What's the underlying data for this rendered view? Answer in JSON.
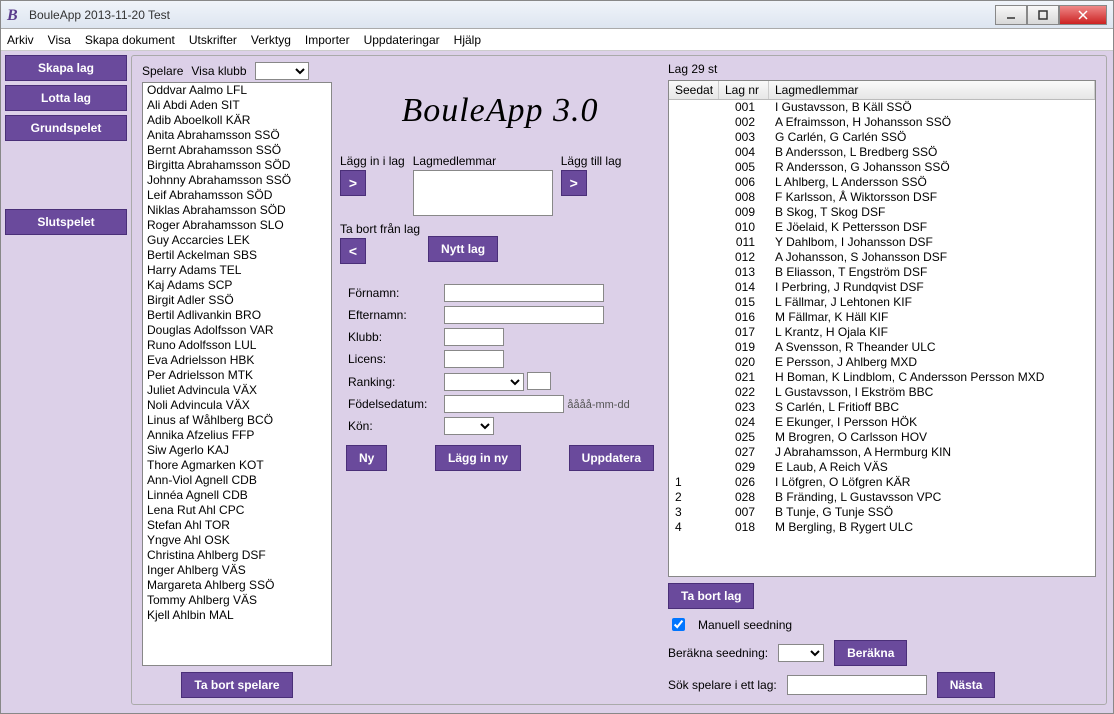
{
  "window": {
    "title": "BouleApp 2013-11-20 Test"
  },
  "menu": {
    "items": [
      "Arkiv",
      "Visa",
      "Skapa dokument",
      "Utskrifter",
      "Verktyg",
      "Importer",
      "Uppdateringar",
      "Hjälp"
    ]
  },
  "sidebar": {
    "skapa_lag": "Skapa lag",
    "lotta_lag": "Lotta lag",
    "grundspelet": "Grundspelet",
    "slutspelet": "Slutspelet"
  },
  "players": {
    "label_spelare": "Spelare",
    "label_visa_klubb": "Visa klubb",
    "list": [
      "Oddvar Aalmo LFL",
      "Ali Abdi Aden SIT",
      "Adib Aboelkoll KÄR",
      "Anita Abrahamsson SSÖ",
      "Bernt Abrahamsson SSÖ",
      "Birgitta Abrahamsson SÖD",
      "Johnny Abrahamsson SSÖ",
      "Leif Abrahamsson SÖD",
      "Niklas Abrahamsson SÖD",
      "Roger Abrahamsson SLO",
      "Guy Accarcies LEK",
      "Bertil Ackelman SBS",
      "Harry Adams TEL",
      "Kaj Adams SCP",
      "Birgit Adler SSÖ",
      "Bertil Adlivankin BRO",
      "Douglas Adolfsson VAR",
      "Runo Adolfsson LUL",
      "Eva Adrielsson HBK",
      "Per Adrielsson MTK",
      "Juliet Advincula VÄX",
      "Noli Advincula VÄX",
      "Linus af Wåhlberg BCÖ",
      "Annika Afzelius FFP",
      "Siw Agerlo KAJ",
      "Thore Agmarken KOT",
      "Ann-Viol Agnell CDB",
      "Linnéa Agnell CDB",
      "Lena Rut Ahl CPC",
      "Stefan Ahl TOR",
      "Yngve Ahl OSK",
      "Christina Ahlberg DSF",
      "Inger Ahlberg VÄS",
      "Margareta Ahlberg SSÖ",
      "Tommy Ahlberg VÄS",
      "Kjell Ahlbin MAL"
    ],
    "ta_bort_spelare": "Ta bort spelare"
  },
  "middle": {
    "logo": "BouleApp 3.0",
    "lagg_in_i_lag": "Lägg in i lag",
    "lagmedlemmar": "Lagmedlemmar",
    "lagg_till_lag": "Lägg till lag",
    "ta_bort_fran_lag": "Ta bort från lag",
    "nytt_lag": "Nytt lag",
    "arrow_r": ">",
    "arrow_l": "<",
    "form": {
      "fornamn": "Förnamn:",
      "efternamn": "Efternamn:",
      "klubb": "Klubb:",
      "licens": "Licens:",
      "ranking": "Ranking:",
      "fodelsedatum": "Födelsedatum:",
      "date_hint": "åååå-mm-dd",
      "kon": "Kön:"
    },
    "ny": "Ny",
    "lagg_in_ny": "Lägg in ny",
    "uppdatera": "Uppdatera"
  },
  "teams": {
    "count_label": "Lag 29 st",
    "col_seedat": "Seedat",
    "col_lagnr": "Lag nr",
    "col_lagmedlemmar": "Lagmedlemmar",
    "rows": [
      {
        "s": "",
        "n": "001",
        "m": "I Gustavsson, B Käll SSÖ"
      },
      {
        "s": "",
        "n": "002",
        "m": "A Efraimsson, H Johansson SSÖ"
      },
      {
        "s": "",
        "n": "003",
        "m": "G Carlén, G Carlén SSÖ"
      },
      {
        "s": "",
        "n": "004",
        "m": "B Andersson, L Bredberg SSÖ"
      },
      {
        "s": "",
        "n": "005",
        "m": "R Andersson, G Johansson SSÖ"
      },
      {
        "s": "",
        "n": "006",
        "m": "L Ahlberg, L Andersson SSÖ"
      },
      {
        "s": "",
        "n": "008",
        "m": "F Karlsson, Å Wiktorsson DSF"
      },
      {
        "s": "",
        "n": "009",
        "m": "B Skog, T Skog DSF"
      },
      {
        "s": "",
        "n": "010",
        "m": "E Jöelaid, K Pettersson DSF"
      },
      {
        "s": "",
        "n": "011",
        "m": "Y Dahlbom, I Johansson DSF"
      },
      {
        "s": "",
        "n": "012",
        "m": "A Johansson, S Johansson DSF"
      },
      {
        "s": "",
        "n": "013",
        "m": "B Eliasson, T Engström DSF"
      },
      {
        "s": "",
        "n": "014",
        "m": "I Perbring, J Rundqvist DSF"
      },
      {
        "s": "",
        "n": "015",
        "m": "L Fällmar, J Lehtonen KIF"
      },
      {
        "s": "",
        "n": "016",
        "m": "M Fällmar, K Häll KIF"
      },
      {
        "s": "",
        "n": "017",
        "m": "L Krantz, H Ojala KIF"
      },
      {
        "s": "",
        "n": "019",
        "m": "A Svensson, R Theander ULC"
      },
      {
        "s": "",
        "n": "020",
        "m": "E Persson, J Ahlberg MXD"
      },
      {
        "s": "",
        "n": "021",
        "m": "H Boman, K Lindblom, C Andersson Persson MXD"
      },
      {
        "s": "",
        "n": "022",
        "m": "L Gustavsson, I Ekström BBC"
      },
      {
        "s": "",
        "n": "023",
        "m": "S Carlén, L Fritioff BBC"
      },
      {
        "s": "",
        "n": "024",
        "m": "E Ekunger, I Persson HÖK"
      },
      {
        "s": "",
        "n": "025",
        "m": "M Brogren, O Carlsson HOV"
      },
      {
        "s": "",
        "n": "027",
        "m": "J Abrahamsson, A Hermburg KIN"
      },
      {
        "s": "",
        "n": "029",
        "m": "E Laub, A Reich VÄS"
      },
      {
        "s": "1",
        "n": "026",
        "m": "I Löfgren, O Löfgren KÄR"
      },
      {
        "s": "2",
        "n": "028",
        "m": "B Fränding, L Gustavsson VPC"
      },
      {
        "s": "3",
        "n": "007",
        "m": "B Tunje, G Tunje SSÖ"
      },
      {
        "s": "4",
        "n": "018",
        "m": "M Bergling, B Rygert ULC"
      }
    ],
    "ta_bort_lag": "Ta bort lag",
    "manuell_seedning": "Manuell seedning",
    "berakna_seedning": "Beräkna seedning:",
    "berakna": "Beräkna",
    "sok_spelare": "Sök spelare i ett lag:",
    "nasta": "Nästa"
  }
}
